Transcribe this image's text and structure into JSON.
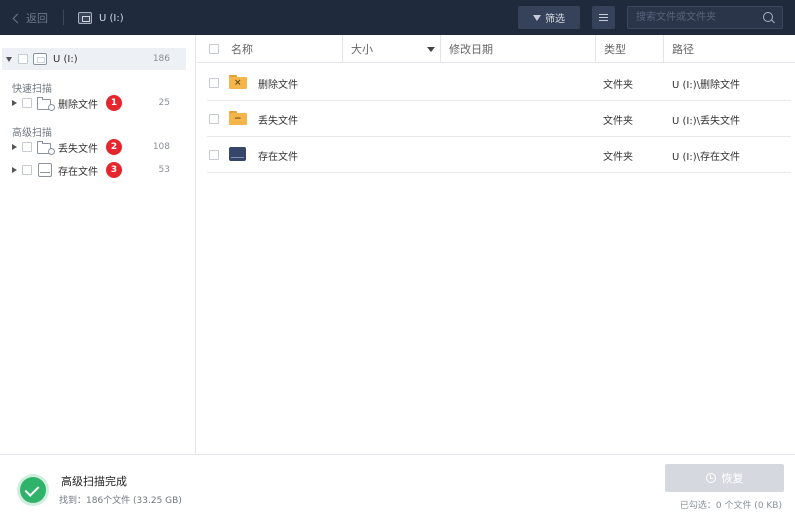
{
  "topbar": {
    "back_label": "返回",
    "drive_title": "U (I:)",
    "filter_label": "筛选",
    "search_placeholder": "搜索文件或文件夹"
  },
  "sidebar": {
    "root": {
      "label": "U (I:)",
      "count": "186"
    },
    "quick_scan_label": "快速扫描",
    "advanced_scan_label": "高级扫描",
    "items": [
      {
        "label": "删除文件",
        "badge": "1",
        "count": "25"
      },
      {
        "label": "丢失文件",
        "badge": "2",
        "count": "108"
      },
      {
        "label": "存在文件",
        "badge": "3",
        "count": "53"
      }
    ]
  },
  "table": {
    "columns": {
      "name": "名称",
      "size": "大小",
      "date": "修改日期",
      "type": "类型",
      "path": "路径"
    },
    "rows": [
      {
        "name": "删除文件",
        "type": "文件夹",
        "path": "U (I:)\\删除文件",
        "icon": "deleted-folder-icon"
      },
      {
        "name": "丢失文件",
        "type": "文件夹",
        "path": "U (I:)\\丢失文件",
        "icon": "lost-folder-icon"
      },
      {
        "name": "存在文件",
        "type": "文件夹",
        "path": "U (I:)\\存在文件",
        "icon": "existing-drive-icon"
      }
    ]
  },
  "footer": {
    "status_title": "高级扫描完成",
    "status_detail": "找到：186个文件 (33.25 GB)",
    "recover_label": "恢复",
    "selected_info": "已勾选：0 个文件 (0 KB)"
  },
  "colors": {
    "topbar_bg": "#1f2a3d",
    "badge_red": "#e5262c",
    "success_green": "#2fb36a",
    "folder_orange": "#f4b54b",
    "disabled_button": "#d5d9df"
  }
}
